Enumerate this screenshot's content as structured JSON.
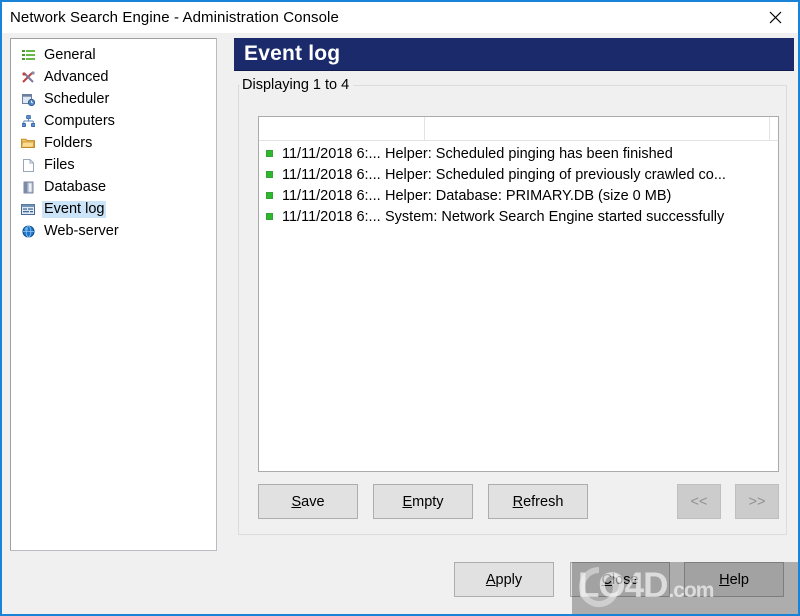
{
  "window": {
    "title": "Network Search Engine - Administration Console",
    "close_icon": "close-icon",
    "border_color": "#1883d7"
  },
  "sidebar": {
    "items": [
      {
        "label": "General",
        "icon": "list-lines-icon",
        "selected": false
      },
      {
        "label": "Advanced",
        "icon": "tools-icon",
        "selected": false
      },
      {
        "label": "Scheduler",
        "icon": "calendar-clock-icon",
        "selected": false
      },
      {
        "label": "Computers",
        "icon": "network-icon",
        "selected": false
      },
      {
        "label": "Folders",
        "icon": "folder-icon",
        "selected": false
      },
      {
        "label": "Files",
        "icon": "file-icon",
        "selected": false
      },
      {
        "label": "Database",
        "icon": "database-icon",
        "selected": false
      },
      {
        "label": "Event log",
        "icon": "event-log-icon",
        "selected": true
      },
      {
        "label": "Web-server",
        "icon": "globe-icon",
        "selected": false
      }
    ],
    "selection_color": "#cce4f7"
  },
  "page": {
    "header_title": "Event log",
    "header_bg": "#1b2a6b",
    "group_legend": "Displaying 1 to 4"
  },
  "event_log": {
    "columns": [
      "",
      ""
    ],
    "rows": [
      {
        "status": "ok",
        "time": "11/11/2018 6:...",
        "message": "Helper: Scheduled pinging has been finished"
      },
      {
        "status": "ok",
        "time": "11/11/2018 6:...",
        "message": "Helper: Scheduled pinging of previously crawled co..."
      },
      {
        "status": "ok",
        "time": "11/11/2018 6:...",
        "message": "Helper: Database: PRIMARY.DB (size 0 MB)"
      },
      {
        "status": "ok",
        "time": "11/11/2018 6:...",
        "message": "System: Network Search Engine started successfully"
      }
    ],
    "status_color": "#2eb82e"
  },
  "actions": {
    "save": {
      "label": "Save",
      "mnemonic": "S",
      "disabled": false
    },
    "empty": {
      "label": "Empty",
      "mnemonic": "E",
      "disabled": false
    },
    "refresh": {
      "label": "Refresh",
      "mnemonic": "R",
      "disabled": false
    },
    "prev": {
      "label": "<<",
      "disabled": true
    },
    "next": {
      "label": ">>",
      "disabled": true
    }
  },
  "dialog_buttons": {
    "apply": {
      "label": "Apply",
      "mnemonic": "A"
    },
    "close": {
      "label": "Close",
      "mnemonic": "C"
    },
    "help": {
      "label": "Help",
      "mnemonic": "H"
    }
  },
  "watermark": {
    "text": "LO4D",
    "suffix": ".com",
    "logo_icon": "circular-arrow-icon"
  }
}
